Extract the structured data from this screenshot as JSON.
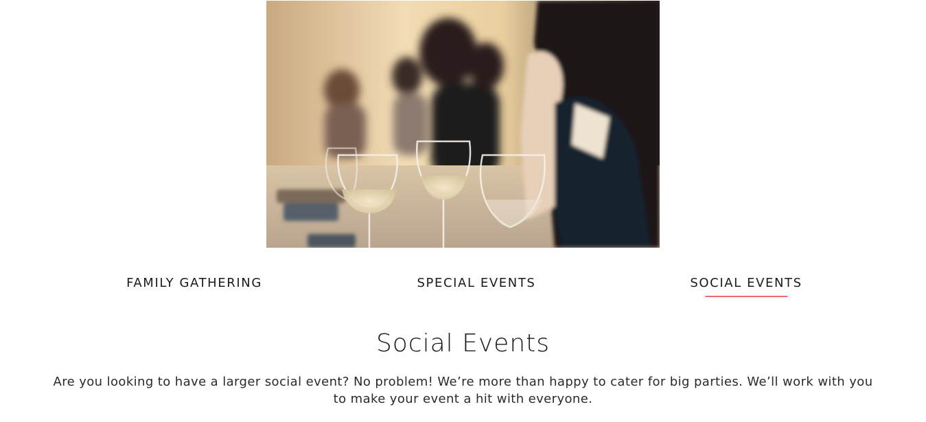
{
  "tabs": [
    {
      "label": "FAMILY GATHERING",
      "active": false
    },
    {
      "label": "SPECIAL EVENTS",
      "active": false
    },
    {
      "label": "SOCIAL EVENTS",
      "active": true
    }
  ],
  "content": {
    "title": "Social Events",
    "text": "Are you looking to have a larger social event? No problem! We’re more than happy to cater for big parties. We’ll work with you to make your event a hit with everyone."
  },
  "colors": {
    "accent": "#ee6b6b",
    "text": "#1a1a1a",
    "background": "#ffffff"
  }
}
